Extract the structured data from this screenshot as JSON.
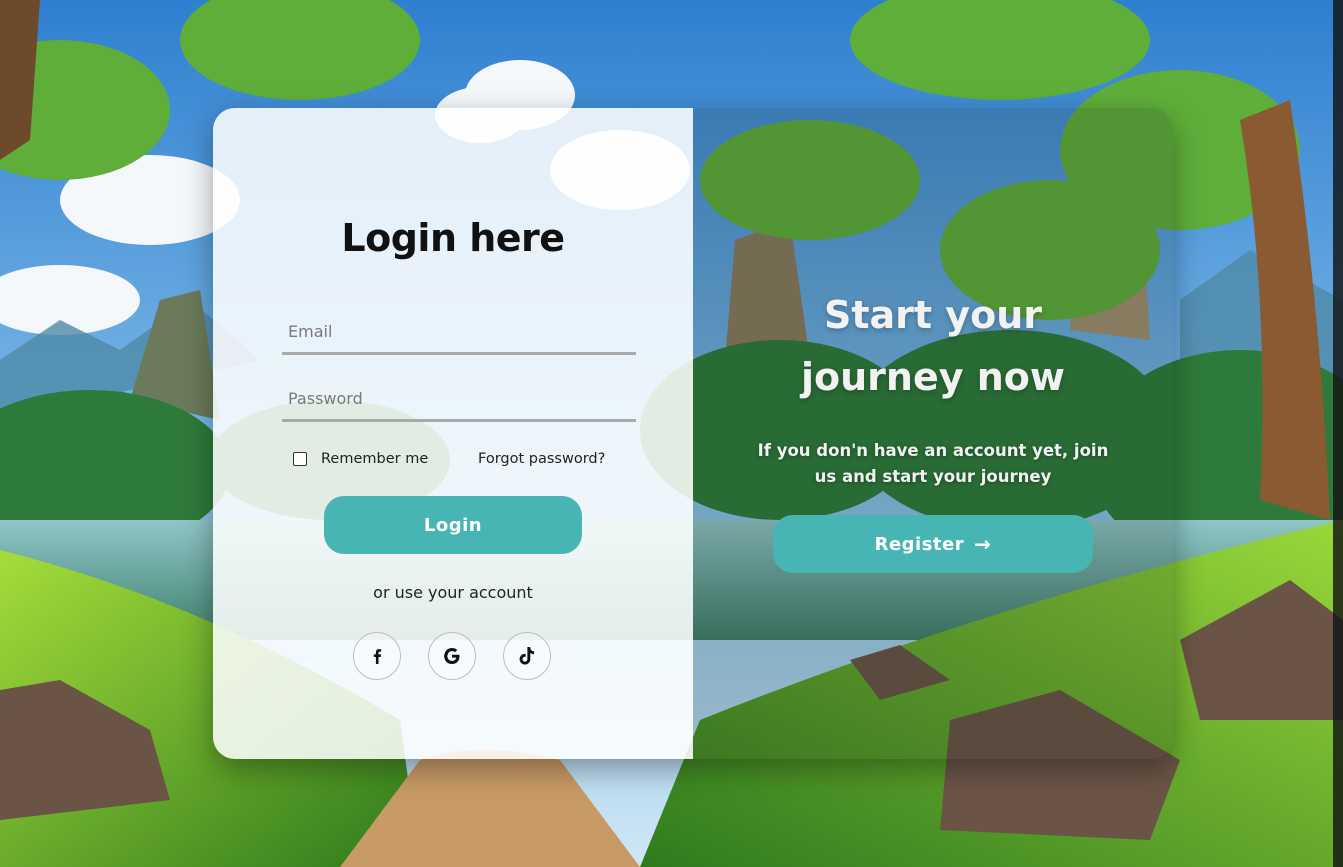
{
  "colors": {
    "accent": "#48b5b5",
    "sky": "#3b8ed8",
    "grass": "#6fbf2e",
    "title_dark": "#111111",
    "title_light": "#f2f2f2"
  },
  "login": {
    "title": "Login here",
    "email_placeholder": "Email",
    "password_placeholder": "Password",
    "remember_label": "Remember me",
    "forgot_label": "Forgot password?",
    "button_label": "Login",
    "or_text": "or use your account",
    "socials": [
      {
        "icon": "facebook-icon"
      },
      {
        "icon": "google-icon"
      },
      {
        "icon": "tiktok-icon"
      }
    ]
  },
  "register": {
    "title_line1": "Start your",
    "title_line2": "journey now",
    "text": "If you don'n have an account yet, join us and start your journey",
    "button_label": "Register",
    "button_icon": "arrow-right-icon"
  }
}
